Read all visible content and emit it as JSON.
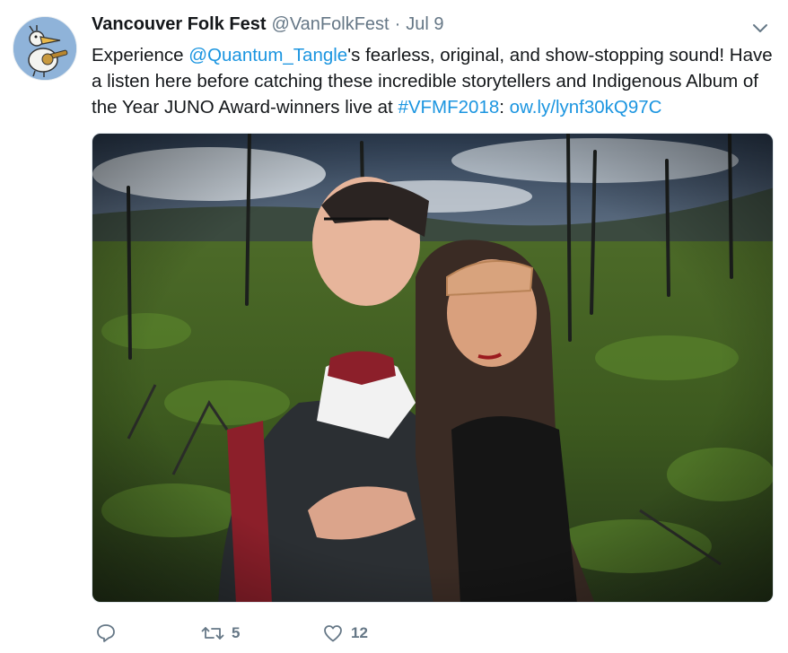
{
  "tweet": {
    "author": {
      "display_name": "Vancouver Folk Fest",
      "handle": "@VanFolkFest"
    },
    "separator": "·",
    "timestamp": "Jul 9",
    "text": {
      "part1": "Experience ",
      "mention": "@Quantum_Tangle",
      "part2": "'s fearless, original, and show-stopping sound! Have a listen here before catching these incredible storytellers and Indigenous Album of the Year JUNO Award-winners live at ",
      "hashtag": "#VFMF2018",
      "part3": ": ",
      "url": "ow.ly/lynf30kQ97C"
    },
    "media": {
      "type": "photo",
      "description_icon": "photo-two-performers-back-to-back"
    },
    "actions": {
      "reply_count": "",
      "retweet_count": "5",
      "like_count": "12"
    },
    "icons": {
      "reply": "reply-icon",
      "retweet": "retweet-icon",
      "like": "heart-icon",
      "menu": "chevron-down-icon"
    },
    "colors": {
      "link": "#1b95e0",
      "secondary_text": "#657786",
      "primary_text": "#14171a"
    }
  }
}
